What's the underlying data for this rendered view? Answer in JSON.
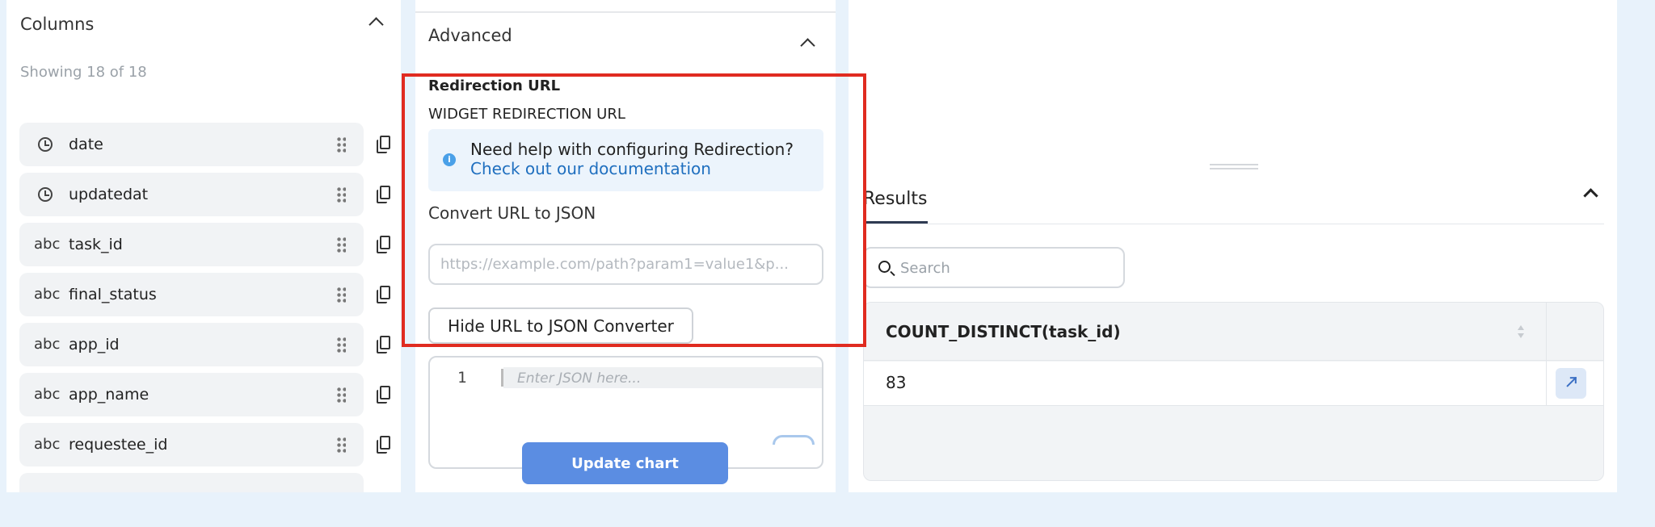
{
  "columns_panel": {
    "title": "Columns",
    "count_text": "Showing 18 of 18",
    "items": [
      {
        "type": "clock",
        "name": "date"
      },
      {
        "type": "clock",
        "name": "updatedat"
      },
      {
        "type": "abc",
        "name": "task_id"
      },
      {
        "type": "abc",
        "name": "final_status"
      },
      {
        "type": "abc",
        "name": "app_id"
      },
      {
        "type": "abc",
        "name": "app_name"
      },
      {
        "type": "abc",
        "name": "requestee_id"
      }
    ]
  },
  "advanced": {
    "title": "Advanced",
    "redirection_label": "Redirection URL",
    "widget_label": "WIDGET REDIRECTION URL",
    "info_icon": "i",
    "info_text": "Need help with configuring Redirection?",
    "info_link": "Check out our documentation",
    "convert_label": "Convert URL to JSON",
    "url_placeholder": "https://example.com/path?param1=value1&p...",
    "hide_button": "Hide URL to JSON Converter",
    "editor_line_number": "1",
    "editor_placeholder": "Enter JSON here...",
    "update_button": "Update chart"
  },
  "results": {
    "tab_label": "Results",
    "search_placeholder": "Search",
    "column_header": "COUNT_DISTINCT(task_id)",
    "row_value": "83"
  },
  "colors": {
    "highlight": "#e02b20",
    "primary_button": "#5b8de2",
    "link": "#1f6fbf",
    "page_background": "#e8f2fb"
  }
}
